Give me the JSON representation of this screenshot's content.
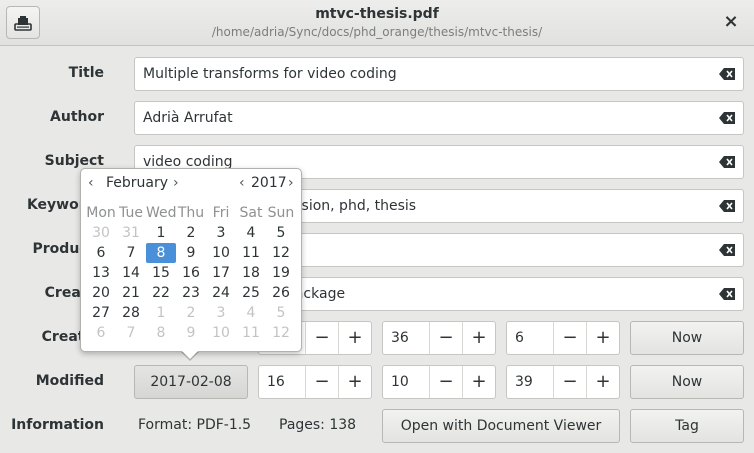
{
  "window": {
    "title": "mtvc-thesis.pdf",
    "subtitle": "/home/adria/Sync/docs/phd_orange/thesis/mtvc-thesis/",
    "close_label": "×"
  },
  "fields": {
    "title": {
      "label": "Title",
      "value": "Multiple transforms for video coding"
    },
    "author": {
      "label": "Author",
      "value": "Adrià Arrufat"
    },
    "subject": {
      "label": "Subject",
      "value": "video coding"
    },
    "keywords": {
      "label": "Keywords",
      "value": "video coding, compression, phd, thesis"
    },
    "producer": {
      "label": "Producer",
      "value": ""
    },
    "creator": {
      "label": "Creator",
      "value": "LaTeX with hyperref package"
    }
  },
  "created": {
    "label": "Created",
    "hour": "",
    "minute": "36",
    "second": "6",
    "now_label": "Now"
  },
  "modified": {
    "label": "Modified",
    "date": "2017-02-08",
    "hour": "16",
    "minute": "10",
    "second": "39",
    "now_label": "Now"
  },
  "information": {
    "label": "Information",
    "format": "Format: PDF-1.5",
    "pages": "Pages: 138",
    "open_label": "Open with Document Viewer",
    "tag_label": "Tag"
  },
  "spin": {
    "minus": "−",
    "plus": "+"
  },
  "calendar": {
    "month": "February",
    "year": "2017",
    "prev": "‹",
    "next": "›",
    "weekdays": [
      "Mon",
      "Tue",
      "Wed",
      "Thu",
      "Fri",
      "Sat",
      "Sun"
    ],
    "weeks": [
      [
        {
          "d": "30",
          "dim": true
        },
        {
          "d": "31",
          "dim": true
        },
        {
          "d": "1"
        },
        {
          "d": "2"
        },
        {
          "d": "3"
        },
        {
          "d": "4"
        },
        {
          "d": "5"
        }
      ],
      [
        {
          "d": "6"
        },
        {
          "d": "7"
        },
        {
          "d": "8",
          "sel": true
        },
        {
          "d": "9"
        },
        {
          "d": "10"
        },
        {
          "d": "11"
        },
        {
          "d": "12"
        }
      ],
      [
        {
          "d": "13"
        },
        {
          "d": "14"
        },
        {
          "d": "15"
        },
        {
          "d": "16"
        },
        {
          "d": "17"
        },
        {
          "d": "18"
        },
        {
          "d": "19"
        }
      ],
      [
        {
          "d": "20"
        },
        {
          "d": "21"
        },
        {
          "d": "22"
        },
        {
          "d": "23"
        },
        {
          "d": "24"
        },
        {
          "d": "25"
        },
        {
          "d": "26"
        }
      ],
      [
        {
          "d": "27"
        },
        {
          "d": "28"
        },
        {
          "d": "1",
          "dim": true
        },
        {
          "d": "2",
          "dim": true
        },
        {
          "d": "3",
          "dim": true
        },
        {
          "d": "4",
          "dim": true
        },
        {
          "d": "5",
          "dim": true
        }
      ],
      [
        {
          "d": "6",
          "dim": true
        },
        {
          "d": "7",
          "dim": true
        },
        {
          "d": "8",
          "dim": true
        },
        {
          "d": "9",
          "dim": true
        },
        {
          "d": "10",
          "dim": true
        },
        {
          "d": "11",
          "dim": true
        },
        {
          "d": "12",
          "dim": true
        }
      ]
    ]
  }
}
